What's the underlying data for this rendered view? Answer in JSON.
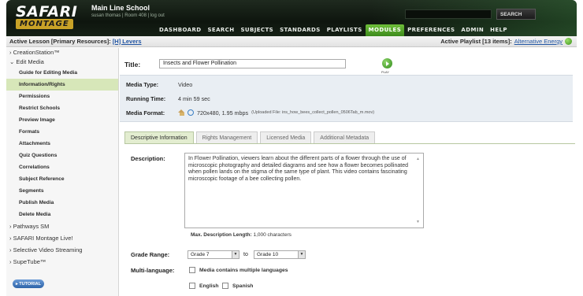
{
  "header": {
    "logo_primary": "SAFARI",
    "logo_secondary": "MONTAGE",
    "school": "Main Line School",
    "user_line": "susan thomas | Room 408 | log out",
    "search_button": "SEARCH"
  },
  "nav": {
    "items": [
      "DASHBOARD",
      "SEARCH",
      "SUBJECTS",
      "STANDARDS",
      "PLAYLISTS",
      "MODULES",
      "PREFERENCES",
      "ADMIN",
      "HELP"
    ],
    "active": "MODULES"
  },
  "lesson_bar": {
    "label": "Active Lesson [Primary Resources]:",
    "link": "[H] Levers",
    "playlist_label": "Active Playlist [13 items]:",
    "playlist_link": "Alternative Energy"
  },
  "sidebar": {
    "creation_station": "› CreationStation™",
    "edit_media": "⌄ Edit Media",
    "items": [
      "Guide for Editing Media",
      "Information/Rights",
      "Permissions",
      "Restrict Schools",
      "Preview Image",
      "Formats",
      "Attachments",
      "Quiz Questions",
      "Correlations",
      "Subject Reference",
      "Segments",
      "Publish Media",
      "Delete Media"
    ],
    "active_item": "Information/Rights",
    "sections": [
      "› Pathways SM",
      "› SAFARI Montage Live!",
      "› Selective Video Streaming",
      "› SupeTube™"
    ],
    "tutorial_button": "▸ TUTORIAL"
  },
  "form": {
    "title_label": "Title:",
    "title_value": "Insects and Flower Pollination",
    "play_label": "PLAY",
    "media_type_label": "Media Type:",
    "media_type_value": "Video",
    "running_time_label": "Running Time:",
    "running_time_value": "4 min 59 sec",
    "media_format_label": "Media Format:",
    "media_format_value": "720x480, 1.95 mbps",
    "media_format_note": "(Uploaded File: ins_how_bees_collect_pollen_0506Tab_m.mov)"
  },
  "tabs": {
    "items": [
      "Descriptive Information",
      "Rights Management",
      "Licensed Media",
      "Additional Metadata"
    ],
    "active": "Descriptive Information"
  },
  "description": {
    "label": "Description:",
    "text": "In Flower Pollination, viewers learn about the different parts of a flower through the use of microscopic photography and detailed diagrams and see how a flower becomes pollinated when pollen lands on the stigma of the same type of plant. This video contains fascinating microscopic footage of a bee collecting pollen.",
    "max_length_label": "Max. Description Length:",
    "max_length_value": "1,000 characters"
  },
  "grade": {
    "label": "Grade Range:",
    "from": "Grade 7",
    "to_label": "to",
    "to": "Grade 10"
  },
  "multi_language": {
    "label": "Multi-language:",
    "checkbox_label": "Media contains multiple languages",
    "options": [
      "English",
      "Spanish"
    ]
  }
}
